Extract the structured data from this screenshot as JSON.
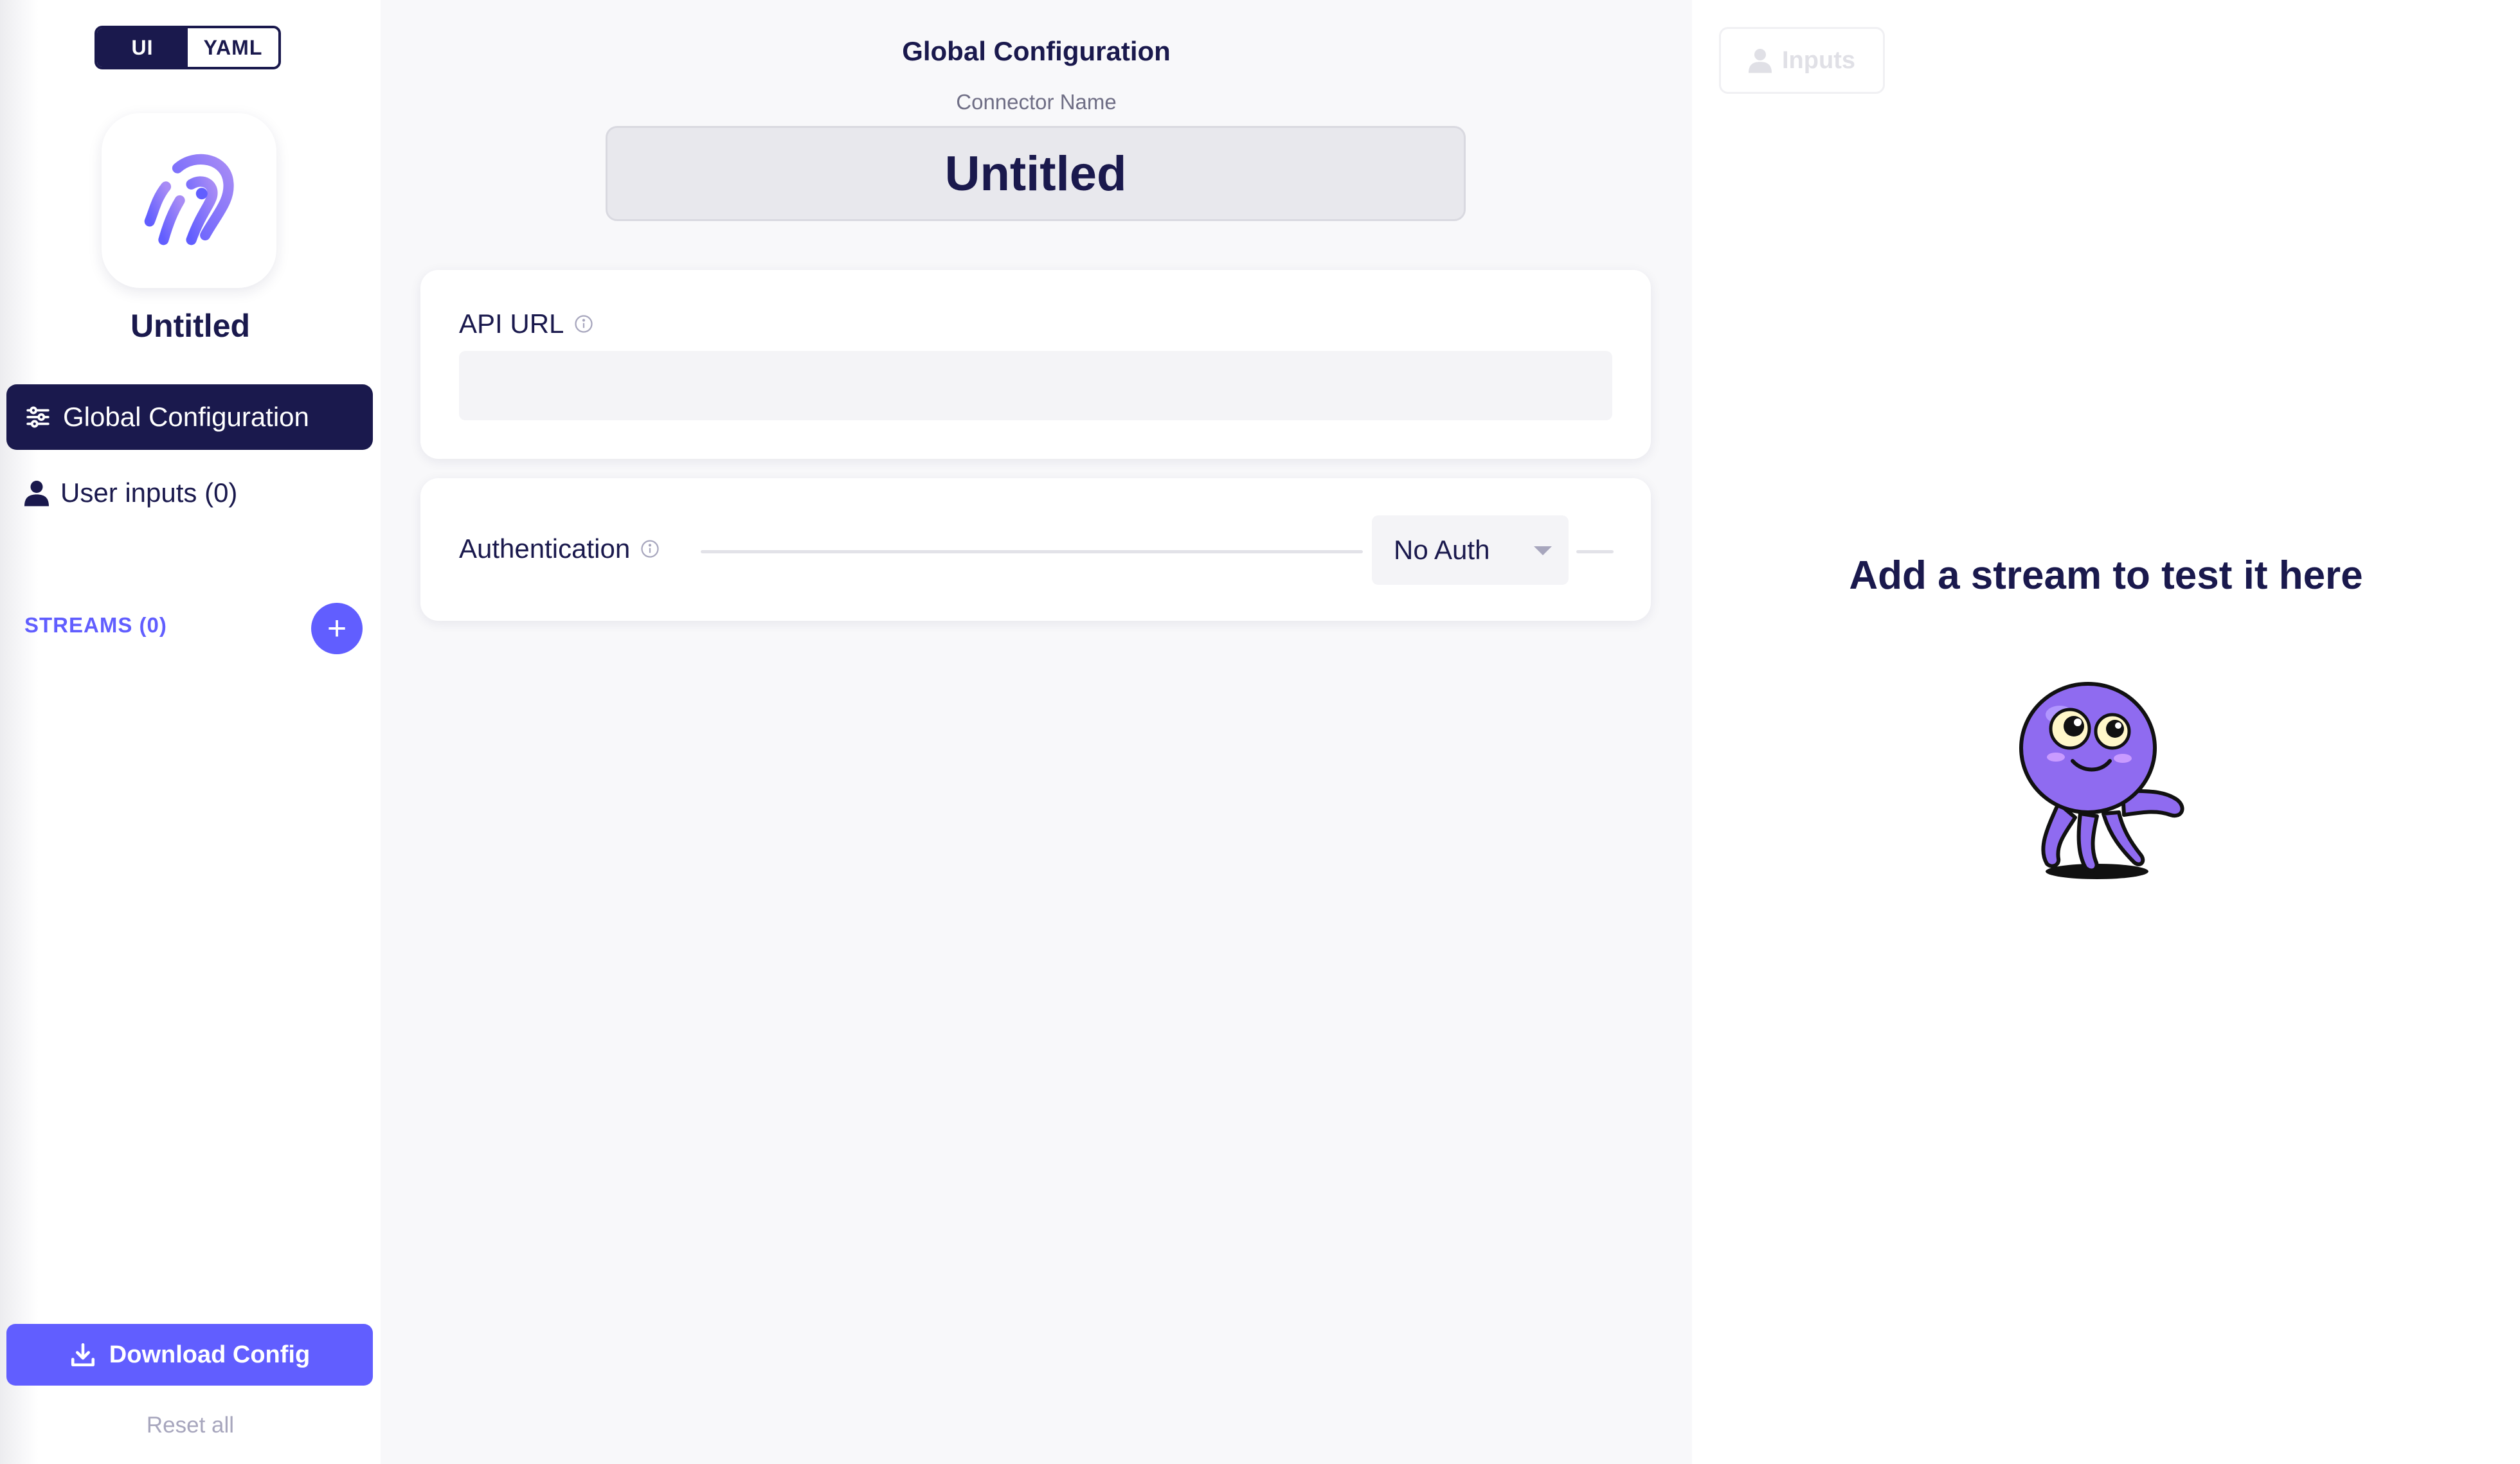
{
  "mode_toggle": {
    "ui_label": "UI",
    "yaml_label": "YAML",
    "selected": "UI"
  },
  "sidebar": {
    "connector_name": "Untitled",
    "nav": {
      "global_config": "Global Configuration",
      "user_inputs": "User inputs (0)"
    },
    "streams_label": "STREAMS (0)",
    "add_stream_symbol": "+",
    "download_label": "Download Config",
    "reset_label": "Reset all"
  },
  "main": {
    "title": "Global Configuration",
    "connector_name_label": "Connector Name",
    "connector_name_value": "Untitled",
    "api_url": {
      "label": "API URL",
      "value": ""
    },
    "authentication": {
      "label": "Authentication",
      "selected": "No Auth"
    }
  },
  "test_panel": {
    "inputs_button": "Inputs",
    "empty_message": "Add a stream to test it here"
  },
  "colors": {
    "primary_dark": "#1a194d",
    "accent": "#615eff",
    "muted": "#a7a6bd",
    "mascot": "#8f6bf0"
  },
  "icons": {
    "logo": "airbyte-logo-icon",
    "global_config": "sliders-icon",
    "user_inputs": "user-icon",
    "info": "info-icon",
    "download": "download-icon",
    "dropdown": "caret-down-icon",
    "mascot": "octopus-mascot-icon"
  }
}
